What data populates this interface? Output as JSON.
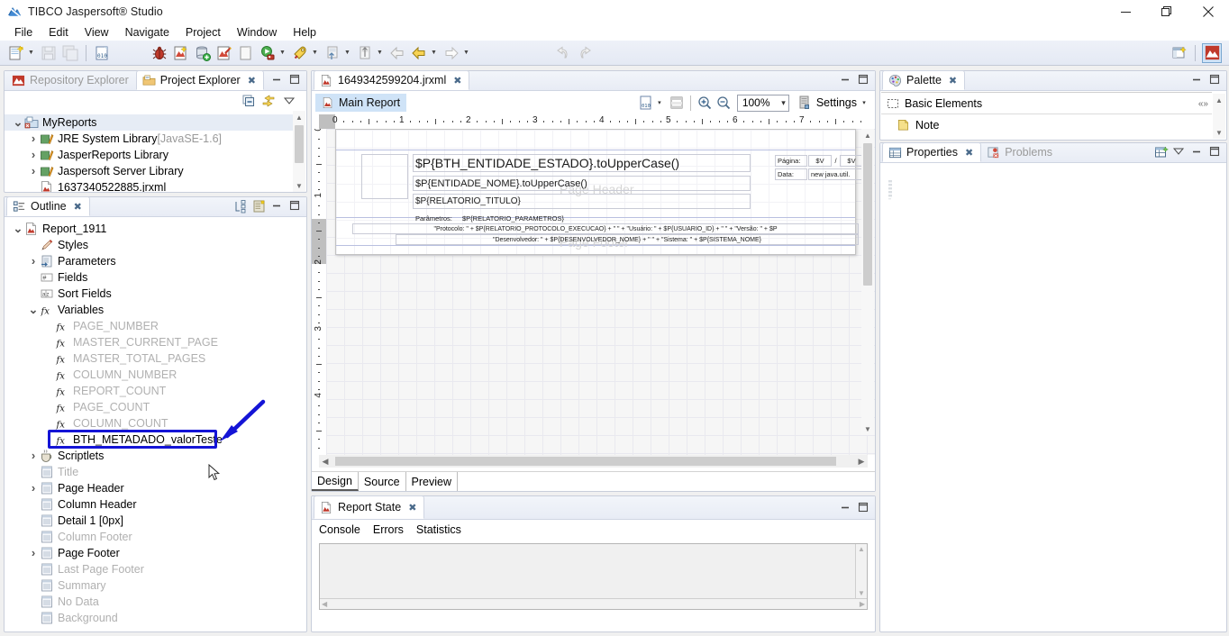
{
  "window": {
    "title": "TIBCO Jaspersoft® Studio",
    "app_icon": "jaspersoft-logo-icon",
    "minimize": "–",
    "maximize": "❐",
    "close": "✕"
  },
  "menubar": {
    "items": [
      "File",
      "Edit",
      "View",
      "Navigate",
      "Project",
      "Window",
      "Help"
    ]
  },
  "toolbar": {
    "groups": [
      {
        "items": [
          {
            "name": "new-wizard-icon",
            "has_dropdown": true
          },
          {
            "name": "save-icon",
            "has_dropdown": false
          },
          {
            "name": "save-all-icon",
            "has_dropdown": false
          }
        ]
      },
      {
        "items": [
          {
            "name": "new-dataset-icon",
            "has_dropdown": false
          }
        ]
      },
      {
        "items": [
          {
            "name": "debug-bug-icon",
            "has_dropdown": false
          },
          {
            "name": "new-report-icon",
            "has_dropdown": false
          },
          {
            "name": "new-datasource-icon",
            "has_dropdown": false
          },
          {
            "name": "compile-report-icon",
            "has_dropdown": false
          },
          {
            "name": "preview-blank-icon",
            "has_dropdown": false
          },
          {
            "name": "run-icon",
            "has_dropdown": true
          },
          {
            "name": "run-as-icon",
            "has_dropdown": true
          },
          {
            "name": "publish-icon",
            "has_dropdown": true
          },
          {
            "name": "export-icon",
            "has_dropdown": true
          },
          {
            "name": "back-grey-icon",
            "has_dropdown": false
          },
          {
            "name": "back-icon",
            "has_dropdown": true
          },
          {
            "name": "forward-icon",
            "has_dropdown": true
          }
        ]
      },
      {
        "items": [
          {
            "name": "undo-grey-icon",
            "has_dropdown": false
          },
          {
            "name": "redo-grey-icon",
            "has_dropdown": false
          }
        ]
      }
    ],
    "right_items": [
      {
        "name": "open-perspective-icon"
      },
      {
        "name": "jaspersoft-perspective-icon",
        "active": true
      }
    ]
  },
  "project_explorer": {
    "tabs": [
      {
        "label": "Repository Explorer",
        "icon": "repository-icon",
        "active": false,
        "closeable": false
      },
      {
        "label": "Project Explorer",
        "icon": "project-folder-icon",
        "active": true,
        "closeable": true
      }
    ],
    "tools": [
      "collapse-all-icon",
      "link-with-editor-icon",
      "view-menu-icon"
    ],
    "tree": [
      {
        "label": "MyReports",
        "icon": "project-icon",
        "depth": 0,
        "expander": "down",
        "dim": false,
        "selected": true
      },
      {
        "label": "JRE System Library",
        "suffix": " [JavaSE-1.6]",
        "icon": "library-icon",
        "depth": 1,
        "expander": "right",
        "dim": false
      },
      {
        "label": "JasperReports Library",
        "icon": "library-icon",
        "depth": 1,
        "expander": "right",
        "dim": false
      },
      {
        "label": "Jaspersoft Server Library",
        "icon": "library-icon",
        "depth": 1,
        "expander": "right",
        "dim": false
      },
      {
        "label": "1637340522885.jrxml",
        "icon": "jrxml-file-icon",
        "depth": 1,
        "expander": "none",
        "dim": false
      }
    ]
  },
  "outline": {
    "tabs": [
      {
        "label": "Outline",
        "icon": "outline-icon",
        "active": true,
        "closeable": true
      }
    ],
    "tools": [
      "sort-tree-icon",
      "show-properties-icon"
    ],
    "tree": [
      {
        "label": "Report_1911",
        "icon": "report-icon",
        "depth": 0,
        "expander": "down",
        "dim": false
      },
      {
        "label": "Styles",
        "icon": "styles-pencil-icon",
        "depth": 1,
        "expander": "none",
        "dim": false
      },
      {
        "label": "Parameters",
        "icon": "parameters-icon",
        "depth": 1,
        "expander": "right",
        "dim": false
      },
      {
        "label": "Fields",
        "icon": "fields-icon",
        "depth": 1,
        "expander": "none",
        "dim": false
      },
      {
        "label": "Sort Fields",
        "icon": "sort-fields-icon",
        "depth": 1,
        "expander": "none",
        "dim": false
      },
      {
        "label": "Variables",
        "icon": "fx-icon",
        "depth": 1,
        "expander": "down",
        "dim": false
      },
      {
        "label": "PAGE_NUMBER",
        "icon": "fx-icon",
        "depth": 2,
        "expander": "none",
        "dim": true
      },
      {
        "label": "MASTER_CURRENT_PAGE",
        "icon": "fx-icon",
        "depth": 2,
        "expander": "none",
        "dim": true
      },
      {
        "label": "MASTER_TOTAL_PAGES",
        "icon": "fx-icon",
        "depth": 2,
        "expander": "none",
        "dim": true
      },
      {
        "label": "COLUMN_NUMBER",
        "icon": "fx-icon",
        "depth": 2,
        "expander": "none",
        "dim": true
      },
      {
        "label": "REPORT_COUNT",
        "icon": "fx-icon",
        "depth": 2,
        "expander": "none",
        "dim": true
      },
      {
        "label": "PAGE_COUNT",
        "icon": "fx-icon",
        "depth": 2,
        "expander": "none",
        "dim": true
      },
      {
        "label": "COLUMN_COUNT",
        "icon": "fx-icon",
        "depth": 2,
        "expander": "none",
        "dim": true
      },
      {
        "label": "BTH_METADADO_valorTeste",
        "icon": "fx-icon",
        "depth": 2,
        "expander": "none",
        "dim": false,
        "highlighted": true
      },
      {
        "label": "Scriptlets",
        "icon": "scriptlets-cup-icon",
        "depth": 1,
        "expander": "right",
        "dim": false
      },
      {
        "label": "Title",
        "icon": "band-icon",
        "depth": 1,
        "expander": "none",
        "dim": true
      },
      {
        "label": "Page Header",
        "icon": "band-icon",
        "depth": 1,
        "expander": "right",
        "dim": false
      },
      {
        "label": "Column Header",
        "icon": "band-icon",
        "depth": 1,
        "expander": "none",
        "dim": false
      },
      {
        "label": "Detail 1 [0px]",
        "icon": "band-icon",
        "depth": 1,
        "expander": "none",
        "dim": false
      },
      {
        "label": "Column Footer",
        "icon": "band-icon",
        "depth": 1,
        "expander": "none",
        "dim": true
      },
      {
        "label": "Page Footer",
        "icon": "band-icon",
        "depth": 1,
        "expander": "right",
        "dim": false
      },
      {
        "label": "Last Page Footer",
        "icon": "band-icon",
        "depth": 1,
        "expander": "none",
        "dim": true
      },
      {
        "label": "Summary",
        "icon": "band-icon",
        "depth": 1,
        "expander": "none",
        "dim": true
      },
      {
        "label": "No Data",
        "icon": "band-icon",
        "depth": 1,
        "expander": "none",
        "dim": true
      },
      {
        "label": "Background",
        "icon": "band-icon",
        "depth": 1,
        "expander": "none",
        "dim": true
      }
    ]
  },
  "editor": {
    "tab": {
      "label": "1649342599204.jrxml",
      "icon": "jrxml-file-icon",
      "closeable": true,
      "active": true
    },
    "main_report_chip": "Main Report",
    "toolbar": {
      "dataset_icon": "dataset-icon",
      "dataset_dropdown": "▾",
      "bands_icon": "show-bands-icon",
      "zoom_in_icon": "zoom-in-icon",
      "zoom_out_icon": "zoom-out-icon",
      "zoom_value": "100%",
      "zoom_chevron": "⌄",
      "settings_icon": "settings-icon",
      "settings_label": "Settings",
      "settings_dropdown": "▾"
    },
    "ruler_h_labels": [
      "0",
      "1",
      "2",
      "3",
      "4",
      "5",
      "6",
      "7"
    ],
    "ruler_v_labels": [
      "0",
      "1",
      "2",
      "3",
      "4"
    ],
    "bottom_tabs": [
      {
        "label": "Design",
        "active": true
      },
      {
        "label": "Source",
        "active": false
      },
      {
        "label": "Preview",
        "active": false
      }
    ],
    "canvas": {
      "band_labels": [
        "Page Header",
        "Page Footer"
      ],
      "elements": [
        {
          "name": "logo-placeholder",
          "text": "",
          "size": "big"
        },
        {
          "name": "entidade-estado-field",
          "text": "$P{BTH_ENTIDADE_ESTADO}.toUpperCase()",
          "size": "big"
        },
        {
          "name": "entidade-nome-field",
          "text": "$P{ENTIDADE_NOME}.toUpperCase()",
          "size": "med"
        },
        {
          "name": "relatorio-titulo-field",
          "text": "$P{RELATORIO_TITULO}",
          "size": "med"
        },
        {
          "name": "pagina-label",
          "text": "Página:",
          "size": "small"
        },
        {
          "name": "pagina-value-field",
          "text": "$V",
          "size": "small"
        },
        {
          "name": "pagina-sep",
          "text": "/",
          "size": "small"
        },
        {
          "name": "pagina-total-field",
          "text": "$V",
          "size": "small"
        },
        {
          "name": "data-label",
          "text": "Data:",
          "size": "small"
        },
        {
          "name": "data-value-field",
          "text": "new java.util.",
          "size": "small"
        },
        {
          "name": "parametros-label",
          "text": "Parâmetros:",
          "size": "small"
        },
        {
          "name": "parametros-field",
          "text": "$P{RELATORIO_PARAMETROS}",
          "size": "small"
        },
        {
          "name": "protocolo-line",
          "text": "\"Protocolo: \" +  $P{RELATORIO_PROTOCOLO_EXECUCAO} + \"    \" + \"Usuário: \" + $P{USUARIO_ID} + \"    \" + \"Versão: \" + $P",
          "size": "small"
        },
        {
          "name": "desenvolvedor-line",
          "text": "\"Desenvolvedor: \" +  $P{DESENVOLVEDOR_NOME} + \"    \" + \"Sistema: \" + $P{SISTEMA_NOME}",
          "size": "small"
        }
      ]
    }
  },
  "report_state": {
    "tab": {
      "label": "Report State",
      "icon": "report-icon",
      "closeable": true
    },
    "subtabs": [
      "Console",
      "Errors",
      "Statistics"
    ],
    "console_text": ""
  },
  "palette": {
    "tab": {
      "label": "Palette",
      "icon": "palette-icon",
      "closeable": true
    },
    "sections": [
      {
        "label": "Basic Elements",
        "icon": "basic-elements-icon",
        "collapse_icon": "collapse-section-icon"
      }
    ],
    "items": [
      {
        "label": "Note",
        "icon": "note-icon"
      }
    ]
  },
  "properties": {
    "tabs": [
      {
        "label": "Properties",
        "icon": "properties-table-icon",
        "active": true,
        "closeable": true
      },
      {
        "label": "Problems",
        "icon": "problems-icon",
        "active": false,
        "closeable": false
      }
    ],
    "tools": [
      "new-property-icon",
      "view-menu-icon",
      "minimize-icon",
      "maximize-icon"
    ],
    "content": ""
  },
  "annotation": {
    "box_target": "BTH_METADADO_valorTeste",
    "color": "#1414d6",
    "arrow": "pointing-left-down"
  },
  "colors": {
    "accent": "#1414d6",
    "tab_active_bg": "#ffffff",
    "chip_bg": "#cfe3f7",
    "toolbar_bg": "#e8ecf5",
    "panel_border": "#c8cedb",
    "dim_text": "#b0b0b0"
  }
}
